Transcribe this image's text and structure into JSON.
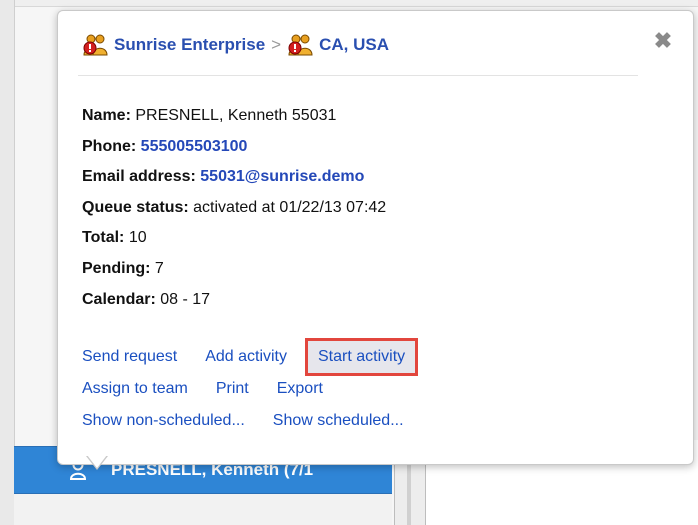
{
  "popup": {
    "breadcrumb": {
      "org": "Sunrise Enterprise",
      "separator": ">",
      "location": "CA, USA"
    },
    "close_label": "✖",
    "details": {
      "name_label": "Name:",
      "name_value": "PRESNELL, Kenneth 55031",
      "phone_label": "Phone:",
      "phone_value": "555005503100",
      "email_label": "Email address:",
      "email_value": "55031@sunrise.demo",
      "queue_label": "Queue status:",
      "queue_value": "activated at 01/22/13 07:42",
      "total_label": "Total:",
      "total_value": "10",
      "pending_label": "Pending:",
      "pending_value": "7",
      "calendar_label": "Calendar:",
      "calendar_value": "08 - 17"
    },
    "actions": {
      "send_request": "Send request",
      "add_activity": "Add activity",
      "start_activity": "Start activity",
      "assign_to_team": "Assign to team",
      "print": "Print",
      "export": "Export",
      "show_non_scheduled": "Show non-scheduled...",
      "show_scheduled": "Show scheduled..."
    }
  },
  "list": {
    "selected_user": "PRESNELL, Kenneth (7/1"
  },
  "colors": {
    "link": "#1a4fc0",
    "header_link": "#2a4fb0",
    "selected_row": "#2f85d6",
    "highlight_border": "#e2463d"
  },
  "icons": {
    "org": "organization-alert-icon",
    "close": "close-icon",
    "user": "person-icon"
  }
}
